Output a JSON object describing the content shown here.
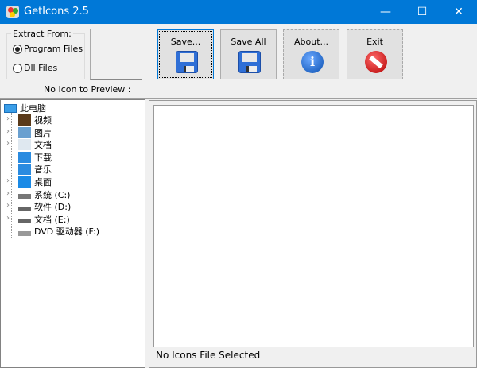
{
  "window": {
    "title": "GetIcons 2.5",
    "minimize": "—",
    "maximize": "☐",
    "close": "✕"
  },
  "extract": {
    "label": "Extract From:",
    "options": [
      {
        "label": "Program Files",
        "selected": true
      },
      {
        "label": "Dll Files",
        "selected": false
      }
    ]
  },
  "preview": {
    "label": "No Icon to Preview :"
  },
  "toolbar": {
    "save": "Save...",
    "save_all": "Save All",
    "about": "About...",
    "exit": "Exit",
    "info_glyph": "i"
  },
  "tree": {
    "root": "此电脑",
    "items": [
      {
        "label": "视频",
        "icon": "video-icon",
        "expandable": true
      },
      {
        "label": "图片",
        "icon": "picture-icon",
        "expandable": true
      },
      {
        "label": "文档",
        "icon": "document-icon",
        "expandable": true
      },
      {
        "label": "下载",
        "icon": "download-icon",
        "expandable": false
      },
      {
        "label": "音乐",
        "icon": "music-icon",
        "expandable": false
      },
      {
        "label": "桌面",
        "icon": "desktop-icon",
        "expandable": true
      },
      {
        "label": "系统 (C:)",
        "icon": "system-drive-icon",
        "expandable": true
      },
      {
        "label": "软件 (D:)",
        "icon": "drive-icon",
        "expandable": true
      },
      {
        "label": "文档 (E:)",
        "icon": "drive-icon",
        "expandable": true
      },
      {
        "label": "DVD 驱动器 (F:)",
        "icon": "dvd-drive-icon",
        "expandable": false
      }
    ]
  },
  "status": "No Icons File Selected"
}
